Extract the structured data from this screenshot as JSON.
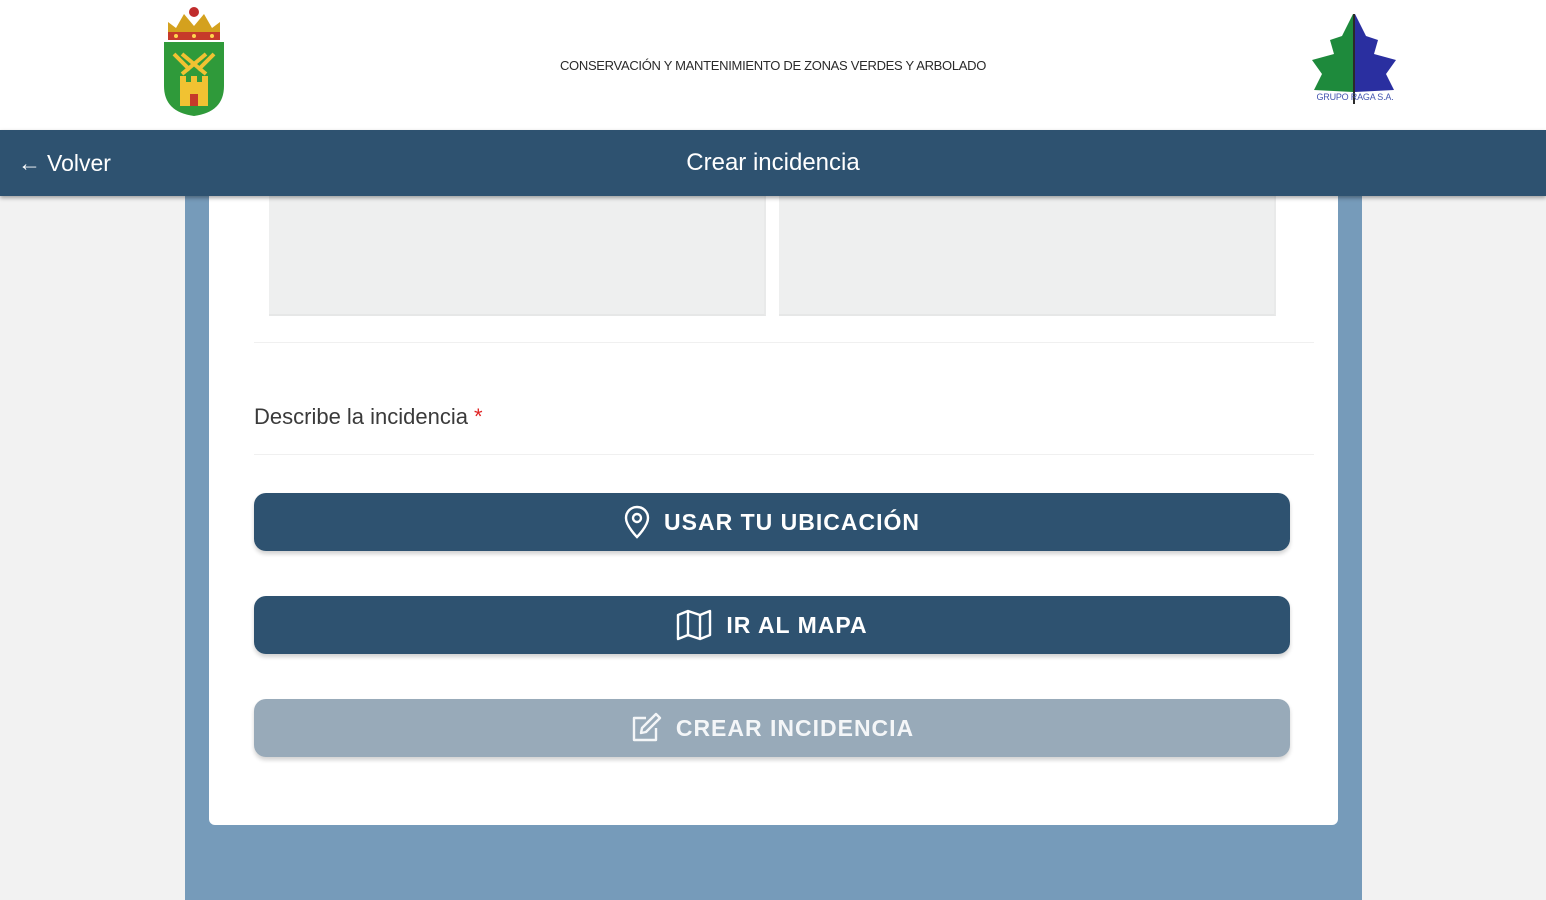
{
  "header": {
    "title": "CONSERVACIÓN Y MANTENIMIENTO DE ZONAS VERDES Y ARBOLADO",
    "partner_logo_text": "GRUPO RAGA S.A."
  },
  "navbar": {
    "back_arrow": "←",
    "back_label": "Volver",
    "title": "Crear incidencia"
  },
  "form": {
    "description_label": "Describe la incidencia",
    "required_mark": "*",
    "use_location_label": "USAR TU UBICACIÓN",
    "go_to_map_label": "IR AL MAPA",
    "create_label": "CREAR INCIDENCIA",
    "create_enabled": false
  },
  "icons": {
    "back": "arrow-left-icon",
    "location": "map-pin-icon",
    "map": "map-icon",
    "create": "edit-icon"
  },
  "colors": {
    "primary": "#2e5270",
    "panel": "#769bba",
    "disabled": "#98aab9",
    "required": "#e02424"
  }
}
